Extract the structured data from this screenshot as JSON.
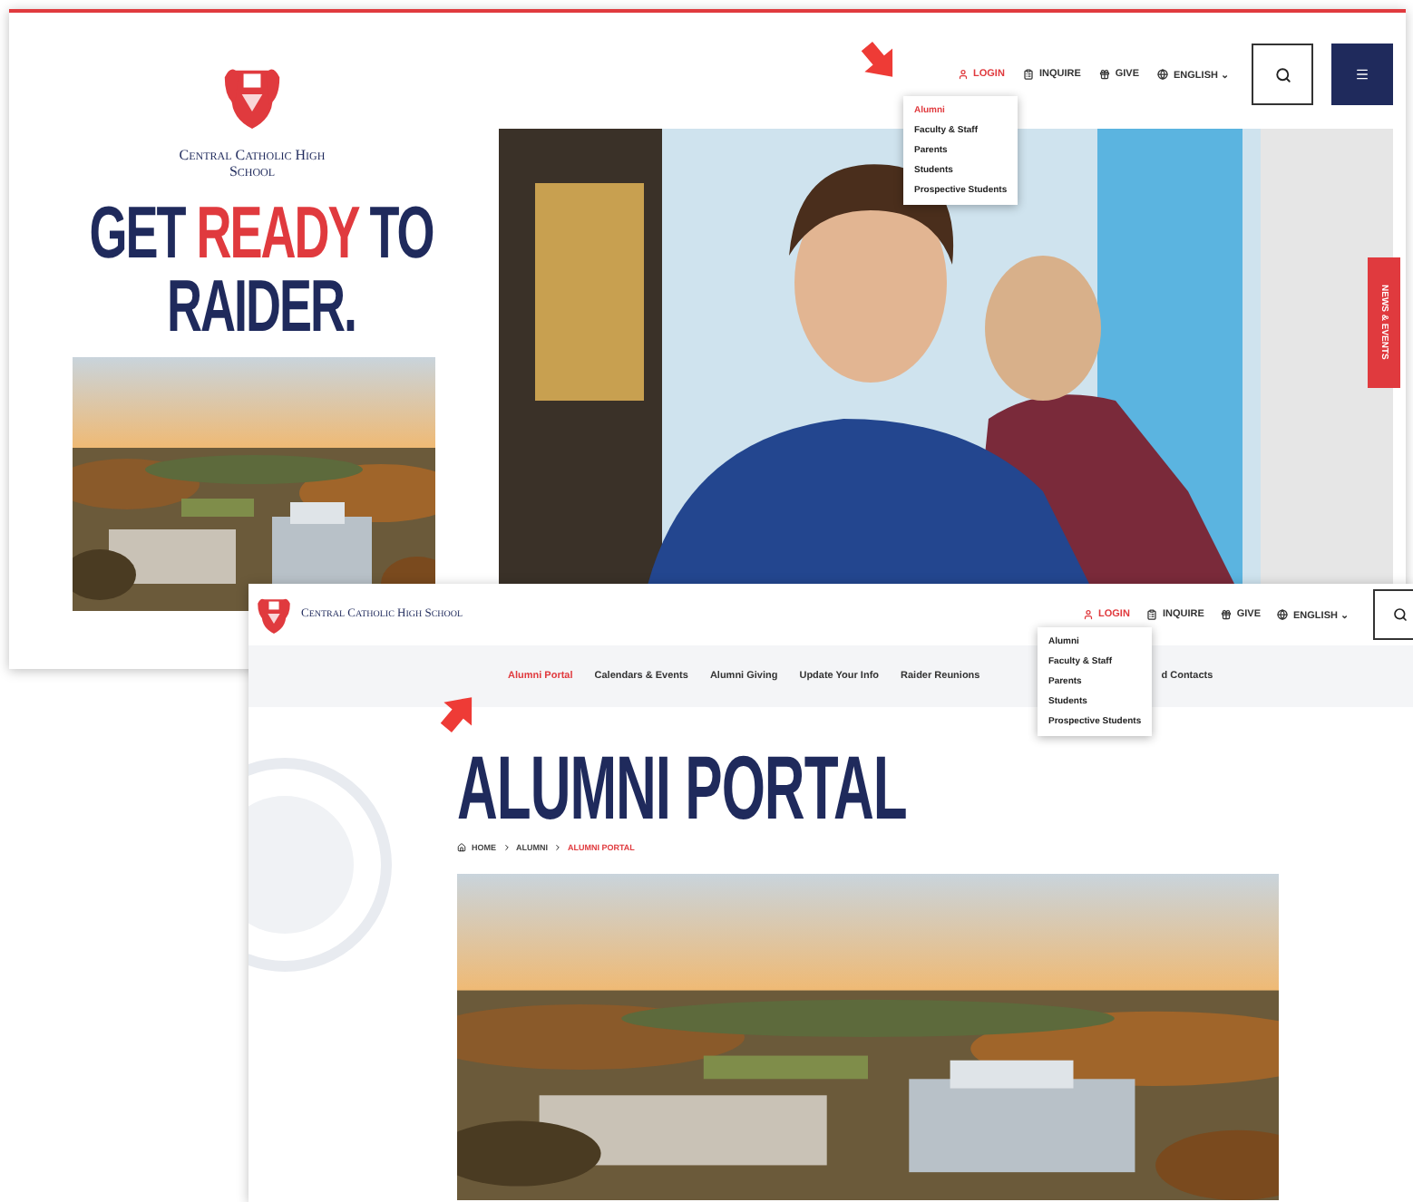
{
  "home_page": {
    "school_name": "Central Catholic High School",
    "headline": [
      {
        "text": "GET ",
        "accent": false
      },
      {
        "text": "READY",
        "accent": true
      },
      {
        "text": " TO RAIDER.",
        "accent": false
      }
    ],
    "utility_nav": [
      {
        "kind": "login",
        "label": "LOGIN",
        "selected": true
      },
      {
        "kind": "inquire",
        "label": "INQUIRE",
        "selected": false
      },
      {
        "kind": "give",
        "label": "GIVE",
        "selected": false
      },
      {
        "kind": "language",
        "label": "ENGLISH ⌄",
        "selected": false
      }
    ],
    "login_menu": [
      {
        "label": "Alumni",
        "selected": true
      },
      {
        "label": "Faculty & Staff",
        "selected": false
      },
      {
        "label": "Parents",
        "selected": false
      },
      {
        "label": "Students",
        "selected": false
      },
      {
        "label": "Prospective Students",
        "selected": false
      }
    ],
    "side_tab": "NEWS & EVENTS"
  },
  "alumni_page": {
    "school_name": "Central Catholic High School",
    "utility_nav": [
      {
        "kind": "login",
        "label": "LOGIN",
        "selected": true
      },
      {
        "kind": "inquire",
        "label": "INQUIRE",
        "selected": false
      },
      {
        "kind": "give",
        "label": "GIVE",
        "selected": false
      },
      {
        "kind": "language",
        "label": "ENGLISH ⌄",
        "selected": false
      }
    ],
    "login_menu": [
      {
        "label": "Alumni",
        "selected": false
      },
      {
        "label": "Faculty & Staff",
        "selected": false
      },
      {
        "label": "Parents",
        "selected": false
      },
      {
        "label": "Students",
        "selected": false
      },
      {
        "label": "Prospective Students",
        "selected": false
      }
    ],
    "section_nav": [
      {
        "label": "Alumni Portal",
        "selected": true
      },
      {
        "label": "Calendars & Events",
        "selected": false
      },
      {
        "label": "Alumni Giving",
        "selected": false
      },
      {
        "label": "Update Your Info",
        "selected": false
      },
      {
        "label": "Raider Reunions",
        "selected": false
      },
      {
        "label": "d Contacts",
        "selected": false
      }
    ],
    "title": "ALUMNI PORTAL",
    "breadcrumb": [
      {
        "label": "HOME",
        "selected": false
      },
      {
        "label": "ALUMNI",
        "selected": false
      },
      {
        "label": "ALUMNI PORTAL",
        "selected": true
      }
    ]
  }
}
